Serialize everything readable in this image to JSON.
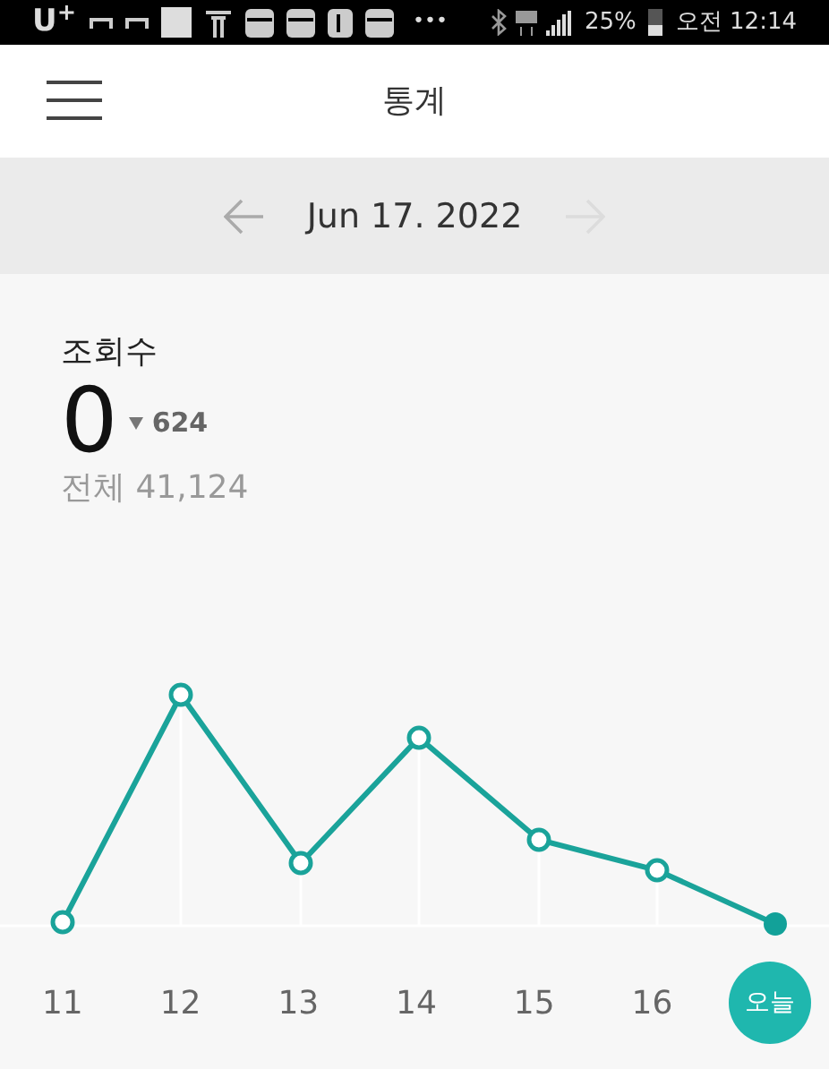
{
  "status_bar": {
    "carrier": "U$^{+}$",
    "more": "•••",
    "battery": "25%",
    "time": "오전 12:14"
  },
  "header": {
    "title": "통계"
  },
  "date_nav": {
    "date": "Jun 17. 2022",
    "prev_disabled": false,
    "next_disabled": true
  },
  "stat": {
    "title": "조회수",
    "value": "0",
    "change": "624",
    "total": "전체 41,124"
  },
  "chart": {
    "days": [
      {
        "label": "11",
        "selected": false
      },
      {
        "label": "12",
        "selected": false
      },
      {
        "label": "13",
        "selected": false
      },
      {
        "label": "14",
        "selected": false
      },
      {
        "label": "15",
        "selected": false
      },
      {
        "label": "16",
        "selected": false
      },
      {
        "label": "오늘",
        "selected": true
      }
    ]
  }
}
